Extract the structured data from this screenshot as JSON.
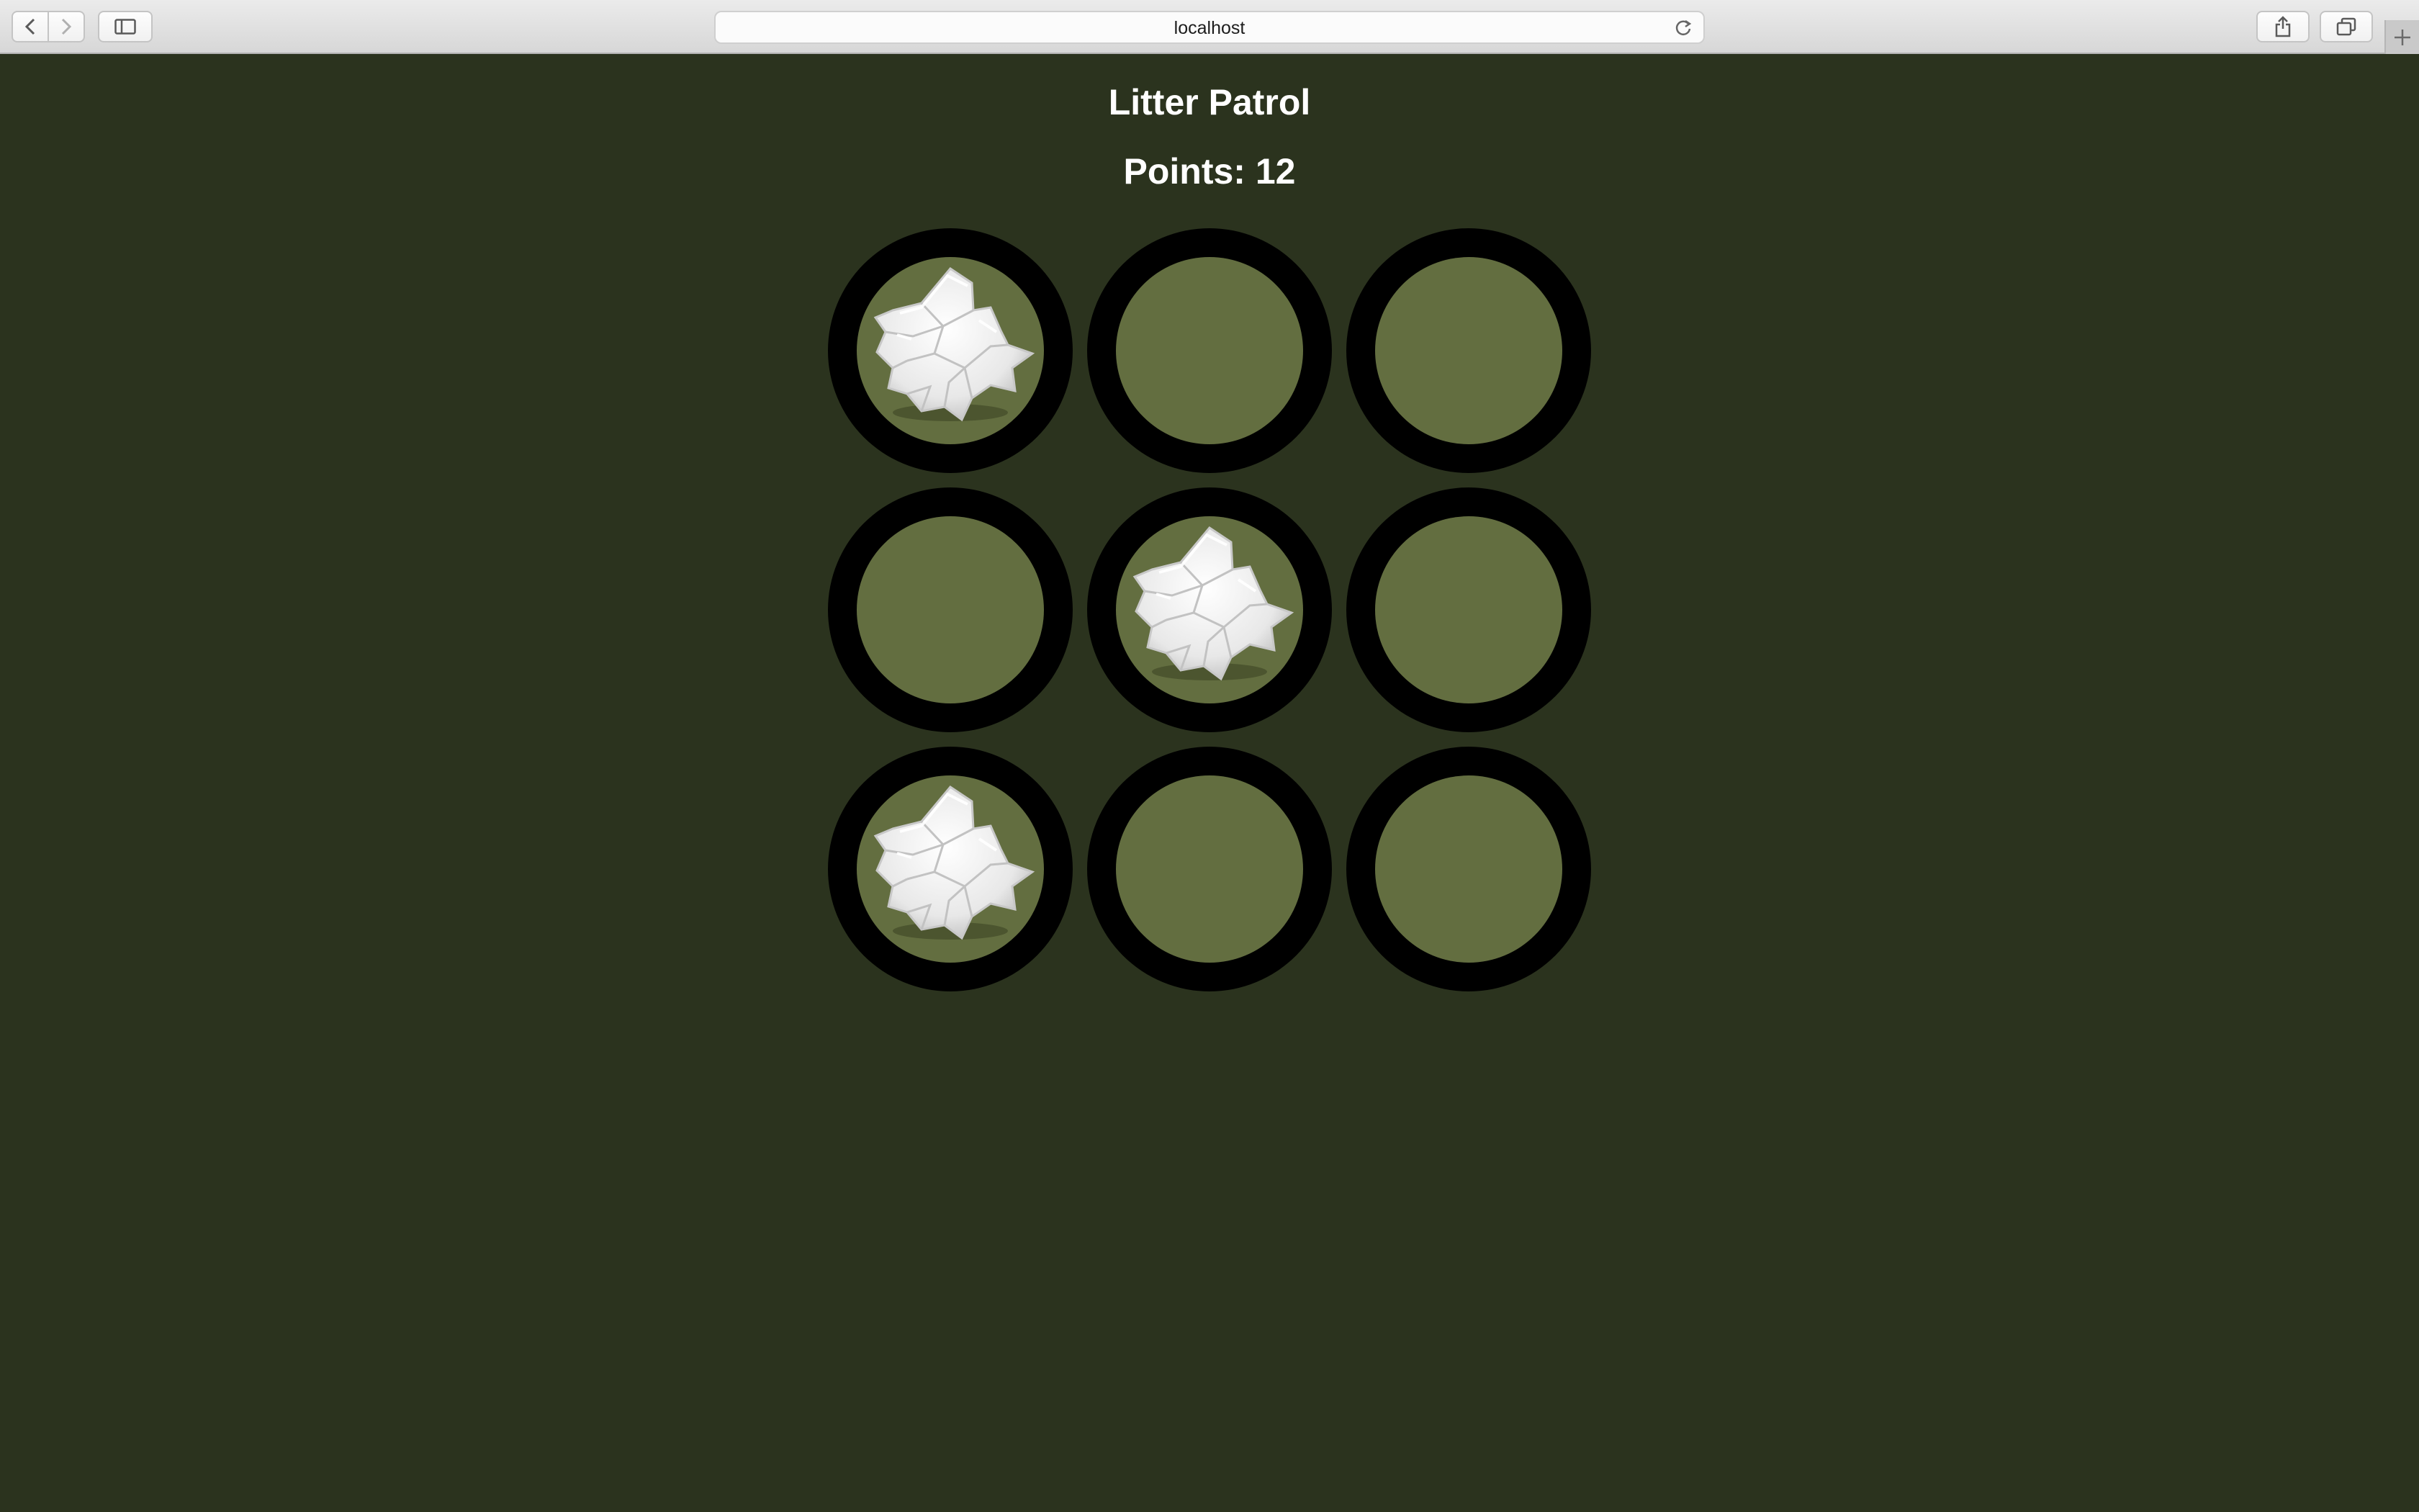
{
  "browser": {
    "url": "localhost"
  },
  "game": {
    "title": "Litter Patrol",
    "score_text": "Points: 12",
    "score": 12
  },
  "board": {
    "rows": 3,
    "cols": 3,
    "holes": [
      {
        "litter": true
      },
      {
        "litter": false
      },
      {
        "litter": false
      },
      {
        "litter": false
      },
      {
        "litter": true
      },
      {
        "litter": false
      },
      {
        "litter": true
      },
      {
        "litter": false
      },
      {
        "litter": false
      }
    ]
  },
  "colors": {
    "background": "#2b331e",
    "hole_rim": "#000000",
    "hole_fill": "#636e40",
    "text": "#ffffff"
  },
  "icons": {
    "litter": "crumpled-paper-icon"
  }
}
